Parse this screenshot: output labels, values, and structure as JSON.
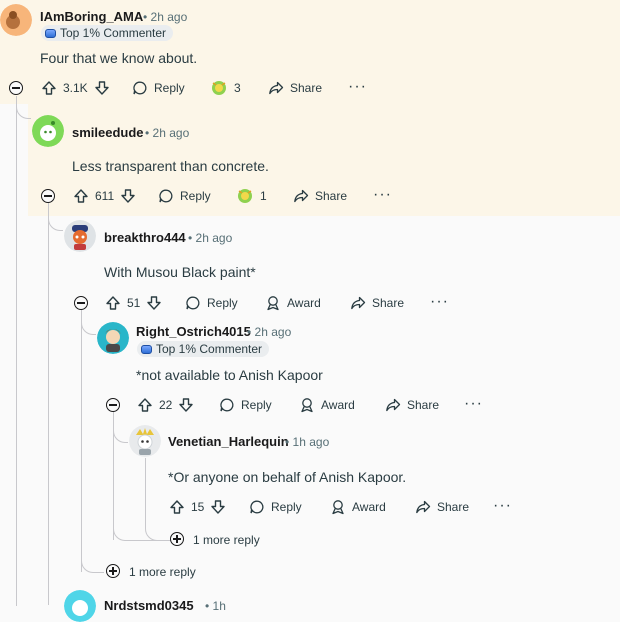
{
  "comments": [
    {
      "username": "IAmBoring_AMA",
      "time": "2h ago",
      "badge": "Top 1% Commenter",
      "body": "Four that we know about.",
      "votes": "3.1K",
      "award_count": "3"
    },
    {
      "username": "smileedude",
      "time": "2h ago",
      "body": "Less transparent than concrete.",
      "votes": "611",
      "award_count": "1"
    },
    {
      "username": "breakthro444",
      "time": "2h ago",
      "body": "With Musou Black paint*",
      "votes": "51"
    },
    {
      "username": "Right_Ostrich4015",
      "time": "2h ago",
      "badge": "Top 1% Commenter",
      "body": "*not available to Anish Kapoor",
      "votes": "22"
    },
    {
      "username": "Venetian_Harlequin",
      "time": "1h ago",
      "body": "*Or anyone on behalf of Anish Kapoor.",
      "votes": "15"
    }
  ],
  "actions": {
    "reply": "Reply",
    "award": "Award",
    "share": "Share"
  },
  "more_replies": {
    "inner": "1 more reply",
    "outer": "1 more reply"
  },
  "partial": {
    "username": "Nrdstsmd0345",
    "time": "1h"
  },
  "colors": {
    "highlight": "#fcf6e8",
    "thread_line": "#c8c8cc",
    "text": "#1a1a1b",
    "meta": "#576f76"
  }
}
